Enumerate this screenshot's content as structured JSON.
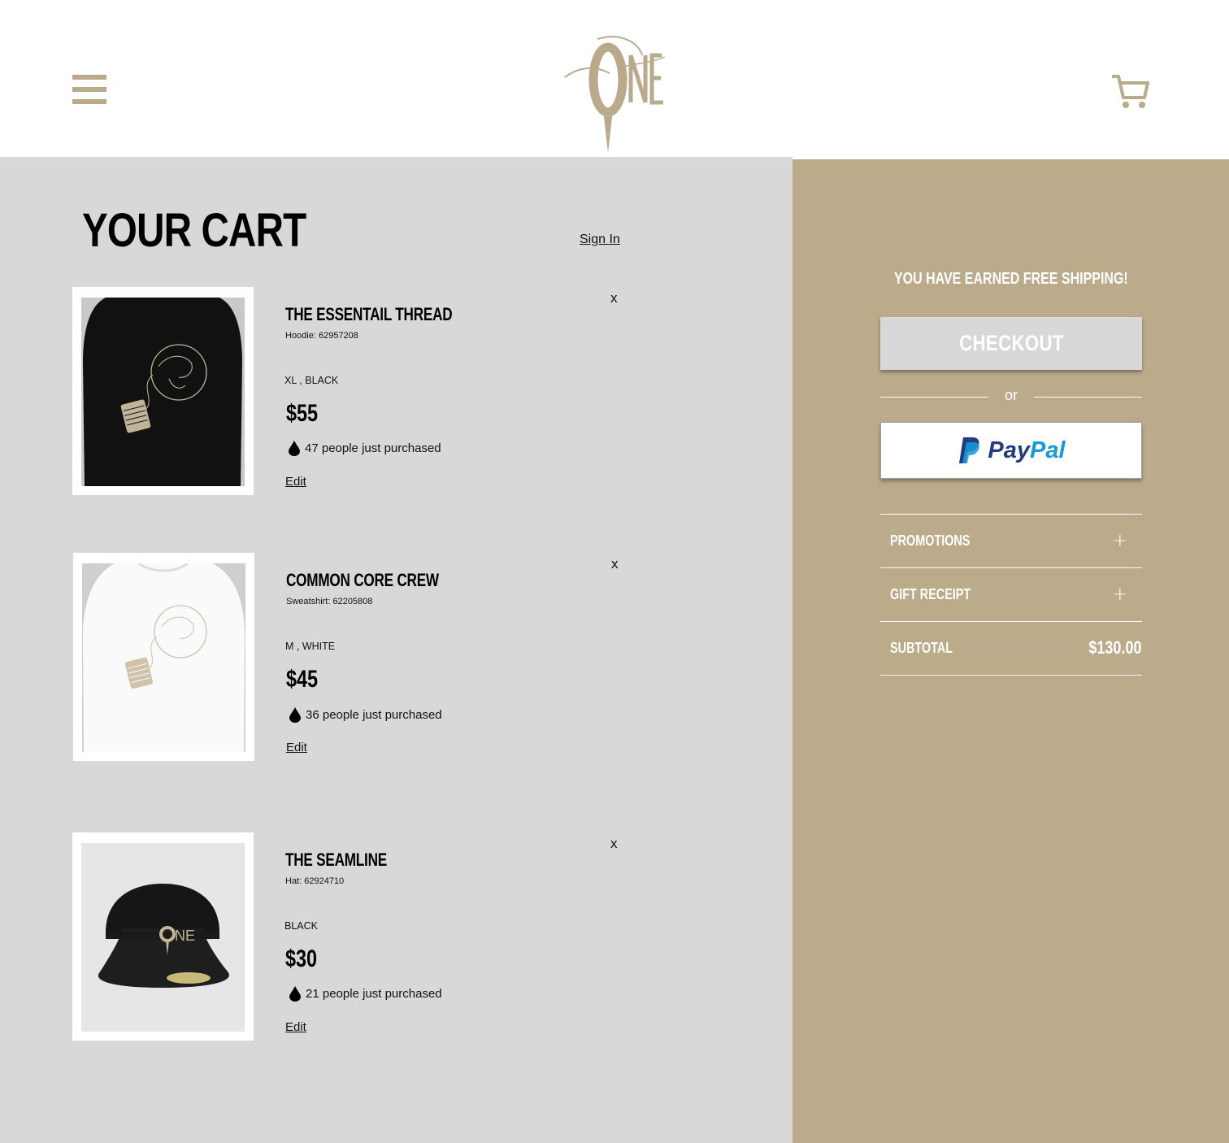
{
  "header": {
    "logo_text": "ONE",
    "menu_icon": "hamburger-menu-icon",
    "cart_icon": "shopping-cart-icon"
  },
  "cart": {
    "title": "YOUR CART",
    "sign_in": "Sign In",
    "items": [
      {
        "name": "THE ESSENTAIL THREAD",
        "sku": "Hoodie: 62957208",
        "variant": "XL , BLACK",
        "price": "$55",
        "purchased": "47 people just purchased",
        "edit": "Edit",
        "remove": "x",
        "image": "black-hoodie-globe-spool"
      },
      {
        "name": "COMMON CORE CREW",
        "sku": "Sweatshirt: 62205808",
        "variant": "M , WHITE",
        "price": "$45",
        "purchased": "36 people just purchased",
        "edit": "Edit",
        "remove": "x",
        "image": "white-sweatshirt-globe-spool"
      },
      {
        "name": "THE SEAMLINE",
        "sku": "Hat: 62924710",
        "variant": "BLACK",
        "price": "$30",
        "purchased": "21 people just purchased",
        "edit": "Edit",
        "remove": "x",
        "image": "black-cap-one-logo"
      }
    ]
  },
  "summary": {
    "free_shipping": "YOU HAVE EARNED FREE SHIPPING!",
    "checkout": "CHECKOUT",
    "or": "or",
    "paypal_pay": "Pay",
    "paypal_pal": "Pal",
    "promotions": "PROMOTIONS",
    "gift_receipt": "GIFT RECEIPT",
    "subtotal_label": "SUBTOTAL",
    "subtotal_value": "$130.00"
  },
  "colors": {
    "brand_tan": "#bbab8b",
    "panel_gray": "#d8d8d8",
    "paypal_dark": "#253b80",
    "paypal_light": "#179bd7"
  }
}
